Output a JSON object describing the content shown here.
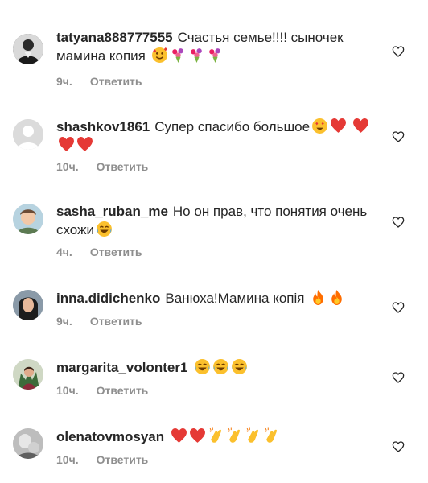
{
  "comments": [
    {
      "username": "tatyana888777555",
      "text": "Счастья семье!!!! сыночек мамина копия",
      "emojis": [
        "smiling-face-with-hearts",
        "bouquet",
        "bouquet",
        "bouquet"
      ],
      "time": "9ч.",
      "reply_label": "Ответить"
    },
    {
      "username": "shashkov1861",
      "text": "Супер спасибо большое",
      "emojis": [
        "heart-eyes",
        "red-heart",
        "red-heart",
        "red-heart",
        "red-heart"
      ],
      "time": "10ч.",
      "reply_label": "Ответить"
    },
    {
      "username": "sasha_ruban_me",
      "text": "Но он прав, что понятия очень схожи",
      "emojis": [
        "tears-of-joy"
      ],
      "time": "4ч.",
      "reply_label": "Ответить"
    },
    {
      "username": "inna.didichenko",
      "text": "Ванюха!Мамина копія",
      "emojis": [
        "fire",
        "fire"
      ],
      "time": "9ч.",
      "reply_label": "Ответить"
    },
    {
      "username": "margarita_volonter1",
      "text": "",
      "emojis": [
        "tears-of-joy",
        "tears-of-joy",
        "tears-of-joy"
      ],
      "time": "10ч.",
      "reply_label": "Ответить"
    },
    {
      "username": "olenatovmosyan",
      "text": "",
      "emojis": [
        "red-heart",
        "red-heart",
        "clapping-hands",
        "clapping-hands",
        "clapping-hands",
        "clapping-hands"
      ],
      "time": "10ч.",
      "reply_label": "Ответить"
    }
  ]
}
